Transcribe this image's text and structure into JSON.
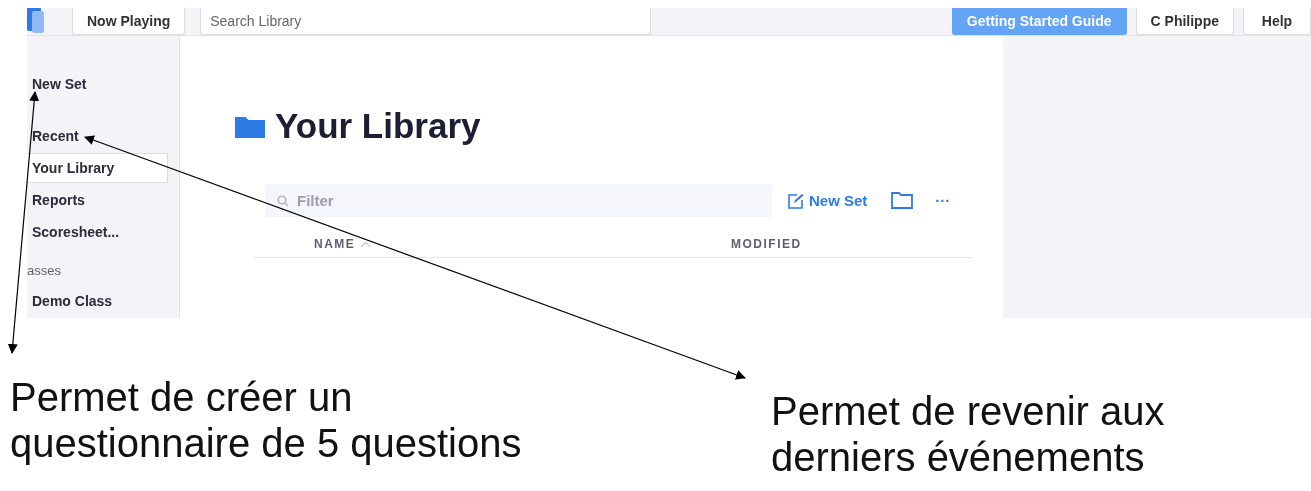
{
  "topbar": {
    "now_playing": "Now Playing",
    "search": {
      "placeholder": "Search Library"
    },
    "guide": "Getting Started Guide",
    "user": "C Philippe",
    "help": "Help"
  },
  "sidebar": {
    "new_set": "New Set",
    "items": [
      {
        "label": "Recent",
        "selected": false
      },
      {
        "label": "Your Library",
        "selected": true
      },
      {
        "label": "Reports",
        "selected": false
      },
      {
        "label": "Scoresheet...",
        "selected": false
      }
    ],
    "section": "asses",
    "classes": [
      "Demo Class"
    ]
  },
  "main": {
    "title": "Your Library",
    "filter": {
      "placeholder": "Filter"
    },
    "new_set": "New Set",
    "more": "···",
    "columns": [
      {
        "label": "NAME",
        "sorted": true
      },
      {
        "label": "MODIFIED",
        "sorted": false
      }
    ]
  },
  "annotations": [
    "Permet de créer un questionnaire de 5 questions",
    "Permet de revenir aux derniers événements"
  ]
}
